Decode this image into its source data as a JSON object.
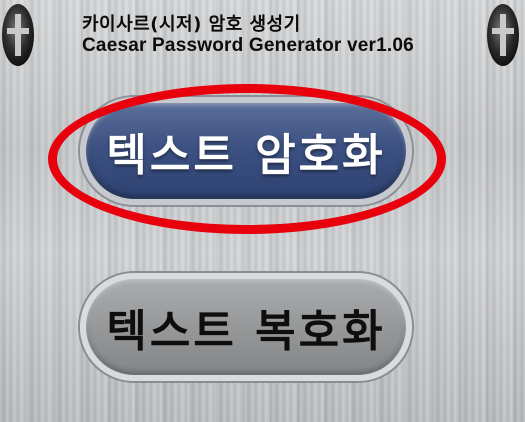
{
  "header": {
    "title_ko": "카이사르(시저) 암호 생성기",
    "title_en": "Caesar Password Generator ver1.06"
  },
  "buttons": {
    "encrypt_label": "텍스트 암호화",
    "decrypt_label": "텍스트 복호화"
  },
  "icons": {
    "left": "cross-badge-icon",
    "right": "cross-badge-icon"
  },
  "colors": {
    "encrypt_button": "#3d5283",
    "decrypt_button": "#969899",
    "highlight": "#e8000c"
  }
}
